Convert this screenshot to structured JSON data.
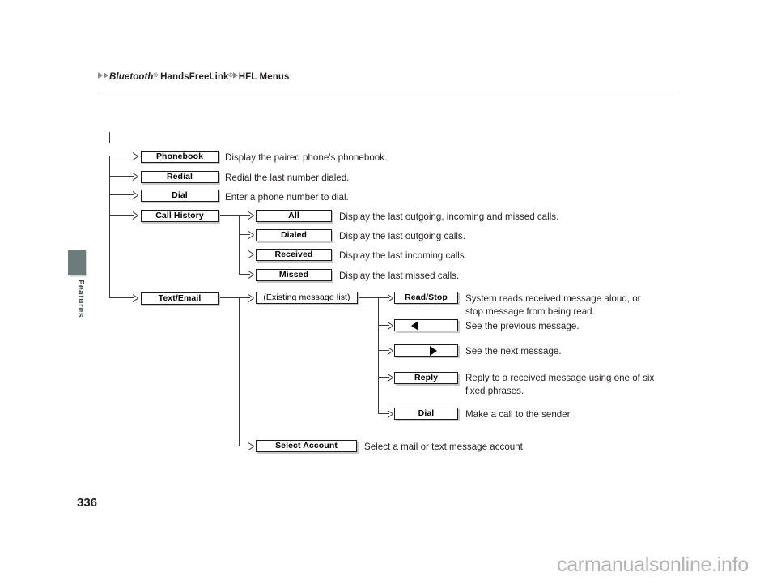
{
  "header": {
    "breadcrumb": {
      "part1": "Bluetooth",
      "part1_sup": "®",
      "part2": "HandsFreeLink",
      "part2_sup": "®",
      "part3": "HFL Menus"
    }
  },
  "sidebar": {
    "tab_label": "Features",
    "tab_color": "#6d7b7a"
  },
  "footer": {
    "page_number": "336",
    "watermark": "carmanualsonline.info"
  },
  "diagram": {
    "level1": [
      {
        "label": "Phonebook",
        "desc": "Display the paired phone’s phonebook."
      },
      {
        "label": "Redial",
        "desc": "Redial the last number dialed."
      },
      {
        "label": "Dial",
        "desc": "Enter a phone number to dial."
      },
      {
        "label": "Call History",
        "desc": ""
      },
      {
        "label": "Text/Email",
        "desc": ""
      }
    ],
    "call_history": [
      {
        "label": "All",
        "desc": "Display the last outgoing, incoming and missed calls."
      },
      {
        "label": "Dialed",
        "desc": "Display the last outgoing calls."
      },
      {
        "label": "Received",
        "desc": "Display the last incoming calls."
      },
      {
        "label": "Missed",
        "desc": "Display the last missed calls."
      }
    ],
    "text_email": [
      {
        "label": "(Existing message list)",
        "desc": ""
      },
      {
        "label": "Select Account",
        "desc": "Select a mail or text message account."
      }
    ],
    "message_actions": [
      {
        "label": "Read/Stop",
        "icon": "",
        "desc": "System reads received message aloud, or\nstop message from being read."
      },
      {
        "label": "",
        "icon": "left-triangle-icon",
        "desc": "See the previous message."
      },
      {
        "label": "",
        "icon": "right-triangle-icon",
        "desc": "See the next message."
      },
      {
        "label": "Reply",
        "icon": "",
        "desc": "Reply to a received message using one of six\nfixed phrases."
      },
      {
        "label": "Dial",
        "icon": "",
        "desc": "Make a call to the sender."
      }
    ]
  }
}
